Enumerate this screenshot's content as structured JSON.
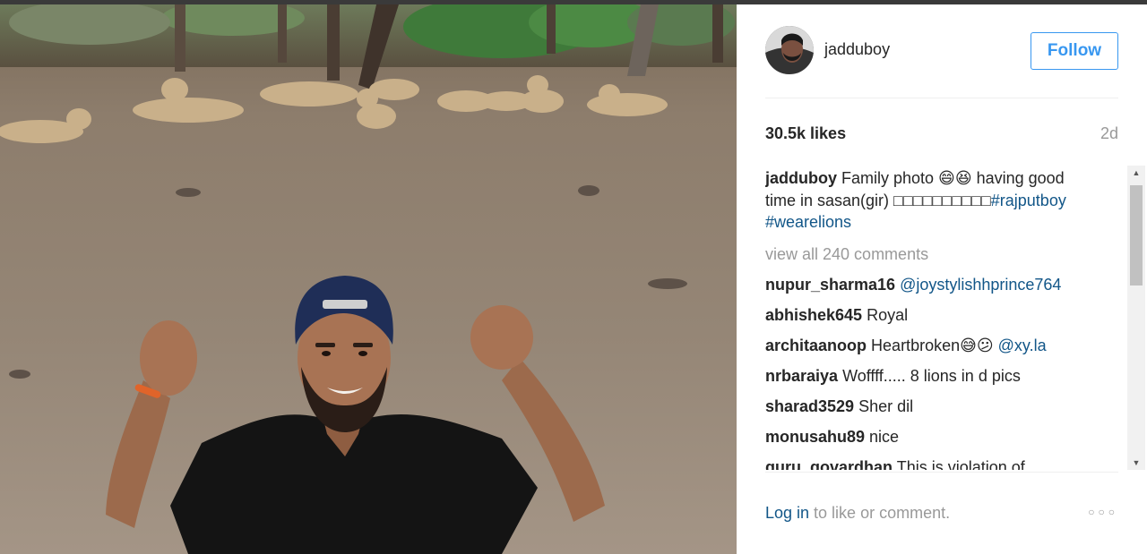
{
  "post": {
    "username": "jadduboy",
    "follow_label": "Follow",
    "likes": "30.5k likes",
    "time_ago": "2d",
    "caption": {
      "user": "jadduboy",
      "text": "Family photo 😄😆 having good time in sasan(gir) □□□□□□□□□□",
      "tag1": "#rajputboy",
      "tag2": "#wearelions"
    },
    "view_all": "view all 240 comments",
    "comments": [
      {
        "user": "nupur_sharma16",
        "text": "",
        "mention": "@joystylishhprince764"
      },
      {
        "user": "abhishek645",
        "text": "Royal",
        "mention": ""
      },
      {
        "user": "architaanoop",
        "text": "Heartbroken😅😕",
        "mention": "@xy.la"
      },
      {
        "user": "nrbaraiya",
        "text": "Woffff..... 8 lions in d pics",
        "mention": ""
      },
      {
        "user": "sharad3529",
        "text": "Sher dil",
        "mention": ""
      },
      {
        "user": "monusahu89",
        "text": "nice",
        "mention": ""
      },
      {
        "user": "guru_govardhan",
        "text": "This is violation of",
        "mention": ""
      }
    ],
    "footer": {
      "login_link": "Log in",
      "login_text": " to like or comment.",
      "more_icon": "more-options-icon"
    }
  },
  "colors": {
    "follow_blue": "#3897f0",
    "link_blue": "#125688",
    "muted": "#999999"
  }
}
